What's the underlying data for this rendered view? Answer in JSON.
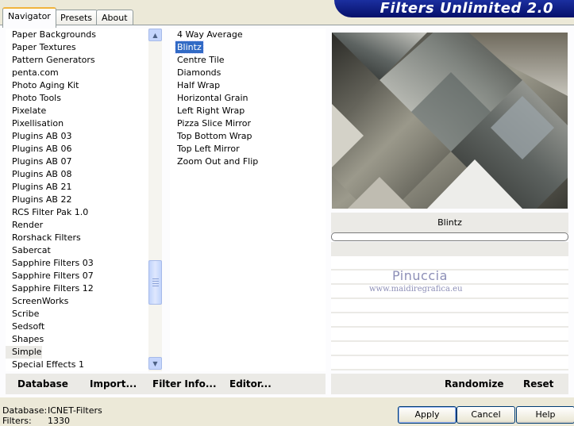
{
  "app": {
    "title": "Filters Unlimited 2.0"
  },
  "tabs": [
    {
      "label": "Navigator"
    },
    {
      "label": "Presets"
    },
    {
      "label": "About"
    }
  ],
  "categories": {
    "items": [
      "Paper Backgrounds",
      "Paper Textures",
      "Pattern Generators",
      "penta.com",
      "Photo Aging Kit",
      "Photo Tools",
      "Pixelate",
      "Pixellisation",
      "Plugins AB 03",
      "Plugins AB 06",
      "Plugins AB 07",
      "Plugins AB 08",
      "Plugins AB 21",
      "Plugins AB 22",
      "RCS Filter Pak 1.0",
      "Render",
      "Rorshack Filters",
      "Sabercat",
      "Sapphire Filters 03",
      "Sapphire Filters 07",
      "Sapphire Filters 12",
      "ScreenWorks",
      "Scribe",
      "Sedsoft",
      "Shapes",
      "Simple",
      "Special Effects 1"
    ],
    "selected": "Simple"
  },
  "filters": {
    "items": [
      "4 Way Average",
      "Blintz",
      "Centre Tile",
      "Diamonds",
      "Half Wrap",
      "Horizontal Grain",
      "Left Right Wrap",
      "Pizza Slice Mirror",
      "Top Bottom Wrap",
      "Top Left Mirror",
      "Zoom Out and Flip"
    ],
    "selected": "Blintz"
  },
  "preview": {
    "filter_name": "Blintz",
    "progress": 0
  },
  "watermark": {
    "line1": "Pinuccia",
    "line2": "www.maidiregrafica.eu"
  },
  "actions": {
    "database": "Database",
    "import": "Import...",
    "filter_info": "Filter Info...",
    "editor": "Editor...",
    "randomize": "Randomize",
    "reset": "Reset"
  },
  "footer": {
    "database_label": "Database:",
    "database_value": "ICNET-Filters",
    "filters_label": "Filters:",
    "filters_value": "1330"
  },
  "buttons": {
    "apply": "Apply",
    "cancel": "Cancel",
    "help": "Help"
  },
  "colors": {
    "banner": "#0a1a86",
    "selection": "#316ac5",
    "face": "#ece9d8"
  }
}
